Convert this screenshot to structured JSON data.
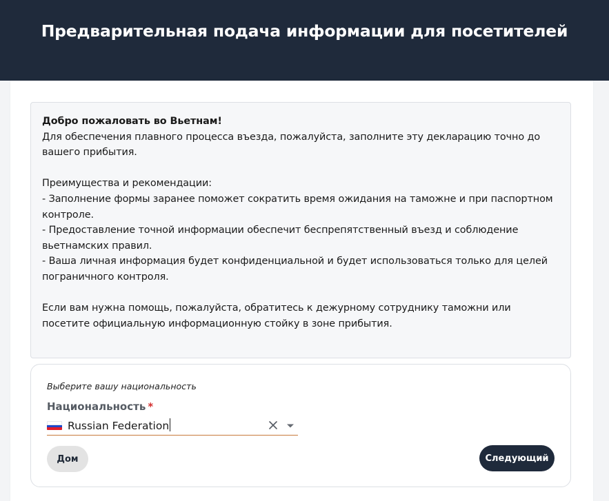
{
  "header": {
    "title": "Предварительная подача информации для посетителей"
  },
  "info": {
    "welcome": "Добро пожаловать во Вьетнам!",
    "intro": "Для обеспечения плавного процесса въезда, пожалуйста, заполните эту декларацию точно до вашего прибытия.",
    "benefits_title": "Преимущества и рекомендации:",
    "benefits": [
      "- Заполнение формы заранее поможет сократить время ожидания на таможне и при паспортном контроле.",
      "- Предоставление точной информации обеспечит беспрепятственный въезд и соблюдение вьетнамских правил.",
      "- Ваша личная информация будет конфиденциальной и будет использоваться только для целей пограничного контроля."
    ],
    "help": "Если вам нужна помощь, пожалуйста, обратитесь к дежурному сотруднику таможни или посетите официальную информационную стойку в зоне прибытия."
  },
  "form": {
    "prompt": "Выберите вашу национальность",
    "nationality_label": "Национальность",
    "required_mark": "*",
    "nationality_value": "Russian Federation",
    "flag_icon": "russia-flag-icon",
    "clear_icon": "close-icon",
    "dropdown_icon": "caret-down-icon"
  },
  "buttons": {
    "home": "Дом",
    "next": "Следующий"
  },
  "colors": {
    "header_bg": "#1f2a3b",
    "next_button_bg": "#1f2a3b",
    "required": "#d32f2f",
    "field_underline": "#c7783a"
  }
}
